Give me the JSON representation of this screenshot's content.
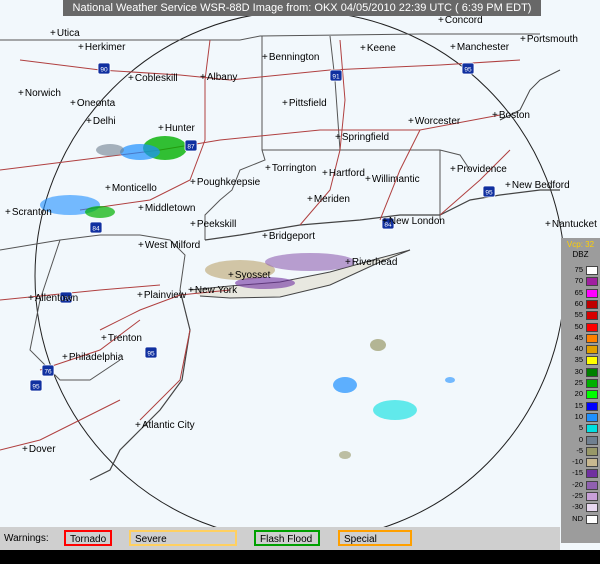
{
  "title": "National Weather Service WSR-88D Image from: OKX 04/05/2010 22:39 UTC ( 6:39 PM EDT)",
  "legend": {
    "vcp": "Vcp: 32",
    "unit": "DBZ",
    "rows": [
      {
        "label": "75",
        "color": "#ffffff"
      },
      {
        "label": "70",
        "color": "#a020a0"
      },
      {
        "label": "65",
        "color": "#ff00ff"
      },
      {
        "label": "60",
        "color": "#c00000"
      },
      {
        "label": "55",
        "color": "#d80000"
      },
      {
        "label": "50",
        "color": "#ff0000"
      },
      {
        "label": "45",
        "color": "#ff8000"
      },
      {
        "label": "40",
        "color": "#e0a000"
      },
      {
        "label": "35",
        "color": "#ffff00"
      },
      {
        "label": "30",
        "color": "#008000"
      },
      {
        "label": "25",
        "color": "#00b000"
      },
      {
        "label": "20",
        "color": "#00ff00"
      },
      {
        "label": "15",
        "color": "#0000ff"
      },
      {
        "label": "10",
        "color": "#1e90ff"
      },
      {
        "label": "5",
        "color": "#00e0e0"
      },
      {
        "label": "0",
        "color": "#708090"
      },
      {
        "label": "-5",
        "color": "#989868"
      },
      {
        "label": "-10",
        "color": "#c8b890"
      },
      {
        "label": "-15",
        "color": "#7030a0"
      },
      {
        "label": "-20",
        "color": "#9060b0"
      },
      {
        "label": "-25",
        "color": "#c8a0d8"
      },
      {
        "label": "-30",
        "color": "#e8d8f0"
      },
      {
        "label": "ND",
        "color": "#ffffff"
      }
    ]
  },
  "warnings": {
    "label": "Warnings:",
    "items": [
      {
        "label": "Tornado",
        "border": "#ff0000"
      },
      {
        "label": "Severe Thunderstorm",
        "border": "#ffd060"
      },
      {
        "label": "Flash Flood",
        "border": "#00a000"
      },
      {
        "label": "Special Marine",
        "border": "#ffa000"
      }
    ]
  },
  "cities": [
    "Utica",
    "Herkimer",
    "Norwich",
    "Oneonta",
    "Cobleskill",
    "Albany",
    "Delhi",
    "Hunter",
    "Bennington",
    "Keene",
    "Concord",
    "Manchester",
    "Portsmouth",
    "Pittsfield",
    "Worcester",
    "Boston",
    "Springfield",
    "Monticello",
    "Poughkeepsie",
    "Torrington",
    "Hartford",
    "Willimantic",
    "Providence",
    "New Bedford",
    "Scranton",
    "Middletown",
    "Meriden",
    "New London",
    "Nantucket",
    "Peekskill",
    "Bridgeport",
    "West Milford",
    "Riverhead",
    "Syosset",
    "Allentown",
    "Plainview",
    "New York",
    "Trenton",
    "Philadelphia",
    "Atlantic City",
    "Dover"
  ],
  "highways": [
    "90",
    "87",
    "91",
    "95",
    "95",
    "84",
    "84",
    "95",
    "195",
    "76",
    "95"
  ],
  "colors": {
    "background": "#f2f8fc",
    "land_border": "#888888",
    "roads": "#b04040",
    "highway_shield": "#1030a0",
    "rings": "#202020"
  }
}
